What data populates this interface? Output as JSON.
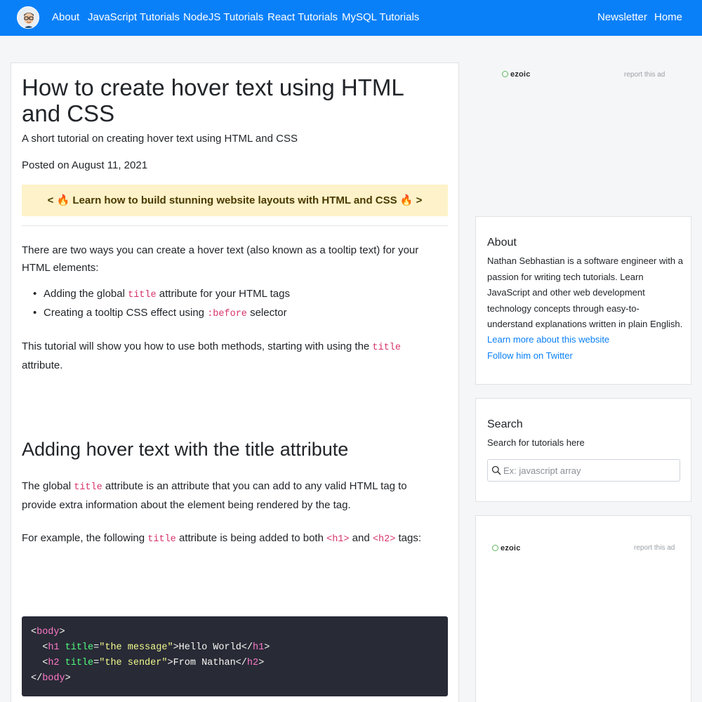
{
  "nav": {
    "left_links": [
      "About",
      "JavaScript Tutorials",
      "NodeJS Tutorials",
      "React Tutorials",
      "MySQL Tutorials"
    ],
    "right_links": [
      "Newsletter",
      "Home"
    ]
  },
  "article": {
    "title": "How to create hover text using HTML and CSS",
    "subtitle": "A short tutorial on creating hover text using HTML and CSS",
    "posted": "Posted on August 11, 2021",
    "promo": "< 🔥 Learn how to build stunning website layouts with HTML and CSS 🔥 >",
    "intro": "There are two ways you can create a hover text (also known as a tooltip text) for your HTML elements:",
    "bullet1": {
      "pre": "Adding the global ",
      "code": "title",
      "post": " attribute for your HTML tags"
    },
    "bullet2": {
      "pre": "Creating a tooltip CSS effect using ",
      "code": ":before",
      "post": " selector"
    },
    "para2": {
      "pre": "This tutorial will show you how to use both methods, starting with using the ",
      "code": "title",
      "post": " attribute."
    },
    "h2": "Adding hover text with the title attribute",
    "para3": {
      "pre": "The global ",
      "code": "title",
      "post": " attribute is an attribute that you can add to any valid HTML tag to provide extra information about the element being rendered by the tag."
    },
    "para4": {
      "pre": "For example, the following ",
      "code1": "title",
      "mid1": " attribute is being added to both ",
      "code2": "<h1>",
      "mid2": " and ",
      "code3": "<h2>",
      "post": " tags:"
    },
    "code_lines": {
      "l1_open": "<",
      "l1_tag": "body",
      "l1_close": ">",
      "l2_indent": "  <",
      "l2_tag": "h1",
      "l2_sp": " ",
      "l2_attr": "title",
      "l2_eq": "=",
      "l2_str": "\"the message\"",
      "l2_text": ">Hello World</",
      "l2_tag2": "h1",
      "l2_end": ">",
      "l3_indent": "  <",
      "l3_tag": "h2",
      "l3_sp": " ",
      "l3_attr": "title",
      "l3_eq": "=",
      "l3_str": "\"the sender\"",
      "l3_text": ">From Nathan</",
      "l3_tag2": "h2",
      "l3_end": ">",
      "l4_open": "</",
      "l4_tag": "body",
      "l4_close": ">"
    }
  },
  "ads": {
    "logo_text": "ezoic",
    "report_text": "report this ad"
  },
  "about_card": {
    "title": "About",
    "text": "Nathan Sebhastian is a software engineer with a passion for writing tech tutorials. Learn JavaScript and other web development technology concepts through easy-to-understand explanations written in plain English.",
    "link1": "Learn more about this website",
    "link2": "Follow him on Twitter"
  },
  "search_card": {
    "title": "Search",
    "text": "Search for tutorials here",
    "placeholder": "Ex: javascript array"
  },
  "colors": {
    "navbar": "#0a80f8",
    "link": "#0a80f8",
    "promo_bg": "#fdf2c9",
    "code_bg": "#282a36"
  }
}
